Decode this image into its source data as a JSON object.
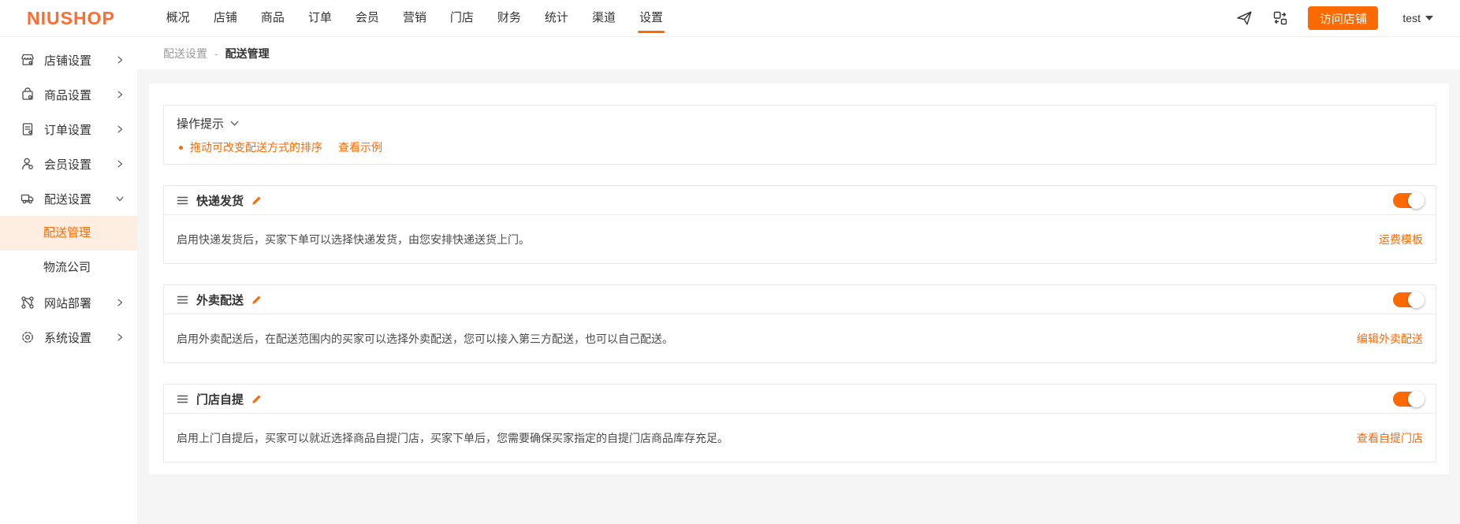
{
  "brand": {
    "logo": "NIUSHOP"
  },
  "topnav": {
    "items": [
      {
        "label": "概况",
        "active": false
      },
      {
        "label": "店铺",
        "active": false
      },
      {
        "label": "商品",
        "active": false
      },
      {
        "label": "订单",
        "active": false
      },
      {
        "label": "会员",
        "active": false
      },
      {
        "label": "营销",
        "active": false
      },
      {
        "label": "门店",
        "active": false
      },
      {
        "label": "财务",
        "active": false
      },
      {
        "label": "统计",
        "active": false
      },
      {
        "label": "渠道",
        "active": false
      },
      {
        "label": "设置",
        "active": true
      }
    ],
    "visit_shop_button": "访问店铺",
    "user": "test"
  },
  "sidebar": {
    "items": [
      {
        "label": "店铺设置",
        "icon": "storefront-icon",
        "expanded": false
      },
      {
        "label": "商品设置",
        "icon": "goods-icon",
        "expanded": false
      },
      {
        "label": "订单设置",
        "icon": "order-icon",
        "expanded": false
      },
      {
        "label": "会员设置",
        "icon": "member-icon",
        "expanded": false
      },
      {
        "label": "配送设置",
        "icon": "delivery-truck-icon",
        "expanded": true,
        "children": [
          {
            "label": "配送管理",
            "active": true
          },
          {
            "label": "物流公司",
            "active": false
          }
        ]
      },
      {
        "label": "网站部署",
        "icon": "network-nodes-icon",
        "expanded": false
      },
      {
        "label": "系统设置",
        "icon": "gear-icon",
        "expanded": false
      }
    ]
  },
  "breadcrumb": {
    "parent": "配送设置",
    "separator": "-",
    "current": "配送管理"
  },
  "tips": {
    "title": "操作提示",
    "bullet": "拖动可改变配送方式的排序",
    "link": "查看示例"
  },
  "cards": [
    {
      "title": "快递发货",
      "enabled": true,
      "description": "启用快递发货后，买家下单可以选择快递发货，由您安排快递送货上门。",
      "action": "运费模板"
    },
    {
      "title": "外卖配送",
      "enabled": true,
      "description": "启用外卖配送后，在配送范围内的买家可以选择外卖配送，您可以接入第三方配送，也可以自己配送。",
      "action": "编辑外卖配送"
    },
    {
      "title": "门店自提",
      "enabled": true,
      "description": "启用上门自提后，买家可以就近选择商品自提门店，买家下单后，您需要确保买家指定的自提门店商品库存充足。",
      "action": "查看自提门店"
    }
  ],
  "colors": {
    "accent": "#ff6a00",
    "active_item_bg": "#fdeee1",
    "toggle_on": "#ff6a00"
  }
}
